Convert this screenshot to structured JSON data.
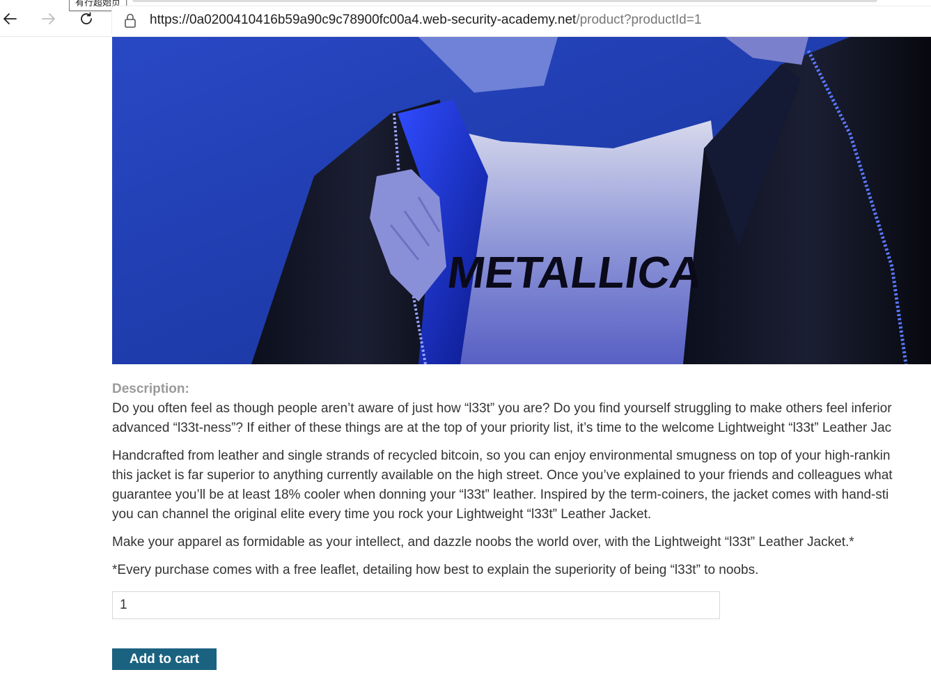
{
  "browser": {
    "tooltip": "有行超始页",
    "url_host": "https://0a0200410416b59a90c9c78900fc00a4.web-security-academy.net",
    "url_path": "/product?productId=1",
    "icons": {
      "back": "back-arrow-icon",
      "forward": "forward-arrow-icon",
      "refresh": "refresh-icon",
      "lock": "lock-icon"
    }
  },
  "product": {
    "image_alt": "leather-jacket-photo",
    "description_label": "Description:",
    "paragraphs": [
      "Do you often feel as though people aren’t aware of just how “l33t” you are? Do you find yourself struggling to make others feel inferior\nadvanced “l33t-ness”? If either of these things are at the top of your priority list, it’s time to the welcome Lightweight “l33t” Leather Jac",
      "Handcrafted from leather and single strands of recycled bitcoin, so you can enjoy environmental smugness on top of your high-rankin\nthis jacket is far superior to anything currently available on the high street. Once you’ve explained to your friends and colleagues what\nguarantee you’ll be at least 18% cooler when donning your “l33t” leather. Inspired by the term-coiners, the jacket comes with hand-sti\nyou can channel the original elite every time you rock your Lightweight “l33t” Leather Jacket.",
      "Make your apparel as formidable as your intellect, and dazzle noobs the world over, with the Lightweight “l33t” Leather Jacket.*",
      "*Every purchase comes with a free leaflet, detailing how best to explain the superiority of being “l33t” to noobs."
    ],
    "quantity_value": "1",
    "add_to_cart_label": "Add to cart",
    "shirt_print": "METALLICA"
  },
  "colors": {
    "button_bg": "#1b6281",
    "label_gray": "#9a9a9a",
    "text": "#333333",
    "photo_blue": "#1f3fb0"
  }
}
